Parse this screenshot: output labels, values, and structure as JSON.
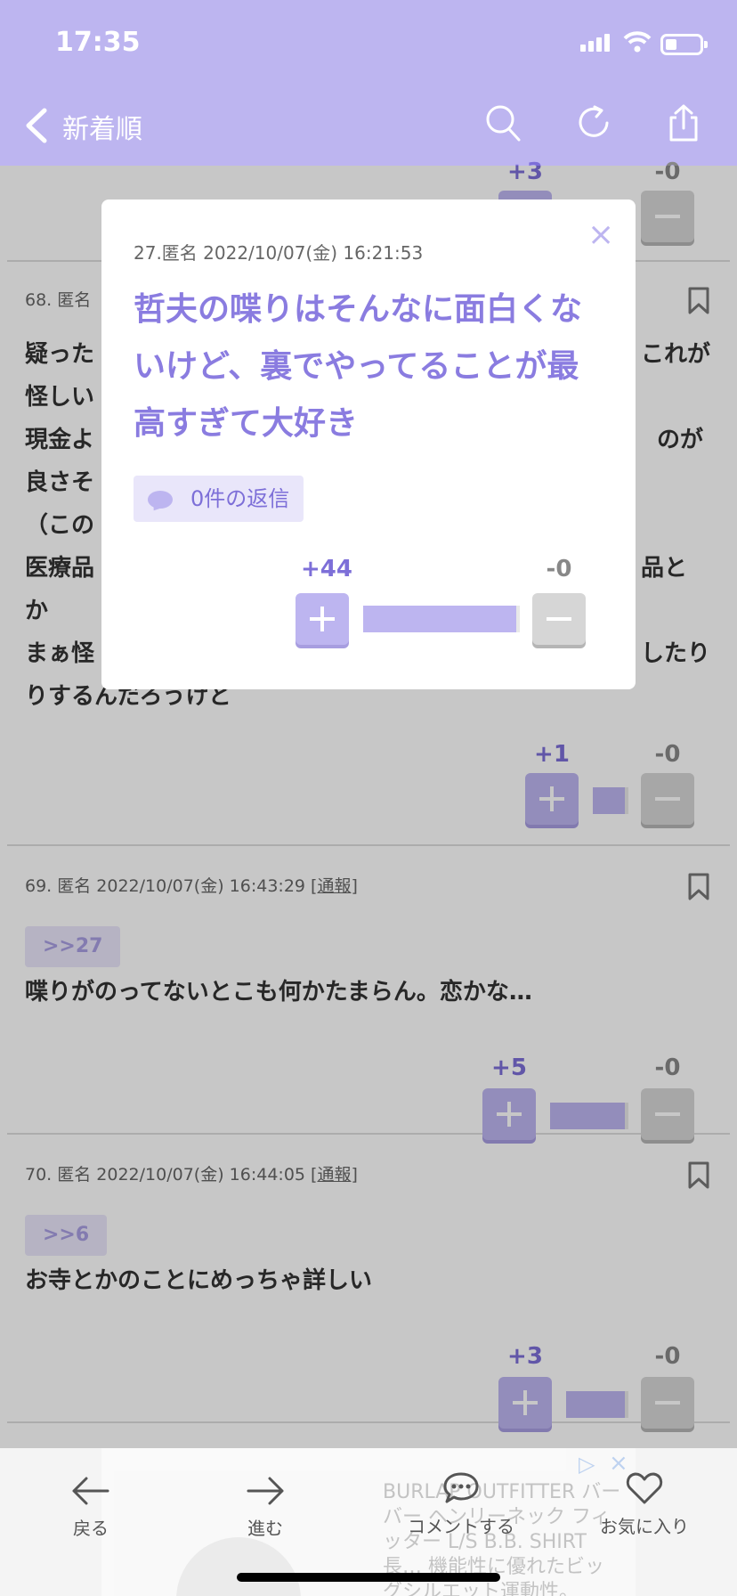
{
  "status_bar": {
    "time": "17:35"
  },
  "nav": {
    "back_label": "新着順"
  },
  "posts": [
    {
      "plus": "+3",
      "minus": "-0"
    },
    {
      "meta": "68. 匿名",
      "lines": [
        "疑った",
        "怪しい",
        "現金よ",
        "良さそ",
        "（この",
        "医療品",
        "か",
        "まぁ怪",
        "りするんだろうけど"
      ],
      "right_fragments": [
        "これが",
        "のが",
        "品と",
        "したり"
      ],
      "plus": "+1",
      "minus": "-0"
    },
    {
      "meta": "69. 匿名 2022/10/07(金) 16:43:29 [",
      "report": "通報",
      "meta_end": "]",
      "anchor": ">>27",
      "text": "喋りがのってないとこも何かたまらん。恋かな…",
      "plus": "+5",
      "minus": "-0"
    },
    {
      "meta": "70. 匿名 2022/10/07(金) 16:44:05 [",
      "report": "通報",
      "meta_end": "]",
      "anchor": ">>6",
      "text": "お寺とかのことにめっちゃ詳しい",
      "plus": "+3",
      "minus": "-0"
    }
  ],
  "modal": {
    "meta": "27.匿名 2022/10/07(金) 16:21:53",
    "text": "哲夫の喋りはそんなに面白くないけど、裏でやってることが最高すぎて大好き",
    "reply_label": "0件の返信",
    "plus": "+44",
    "minus": "-0",
    "close": "×"
  },
  "toolbar": {
    "back": "戻る",
    "forward": "進む",
    "comment": "コメントする",
    "favorite": "お気に入り"
  },
  "ad": {
    "text": "BURLAP OUTFITTER バー バー ヘンリーネック フィッター L/S B.B. SHIRT 長… 機能性に優れたビッグシルエット運動性。",
    "close": "×",
    "choice": "▷"
  },
  "colors": {
    "accent": "#bdb5f0",
    "accent_text": "#8a7ce0"
  }
}
